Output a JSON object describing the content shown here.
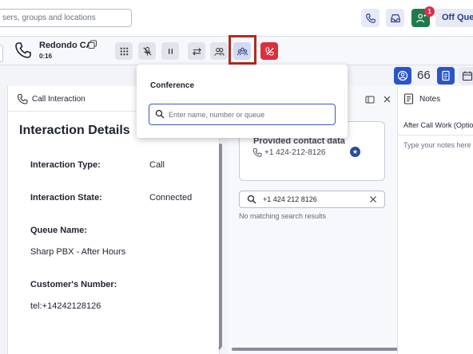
{
  "topbar": {
    "search_placeholder": "sers, groups and locations",
    "notification_count": "1",
    "status_label": "Off Que"
  },
  "call": {
    "caller_name": "Redondo CA",
    "timer": "0:16"
  },
  "row2": {
    "count": "66"
  },
  "conference": {
    "title": "Conference",
    "placeholder": "Enter name, number or queue"
  },
  "interaction_panel": {
    "header": "Call Interaction",
    "title": "Interaction Details",
    "fields": [
      {
        "label": "Interaction Type:",
        "value": "Call"
      },
      {
        "label": "Interaction State:",
        "value": "Connected"
      },
      {
        "label": "Queue Name:",
        "value": "Sharp PBX - After Hours"
      },
      {
        "label": "Customer's Number:",
        "value": "tel:+14242128126"
      }
    ]
  },
  "contact_panel": {
    "card_title": "Provided contact data",
    "card_phone": "+1 424-212-8126",
    "search_value": "+1 424 212 8126",
    "no_results": "No matching search results"
  },
  "notes_panel": {
    "header": "Notes",
    "subtitle": "After Call Work (Optio",
    "placeholder": "Type your notes here"
  },
  "colors": {
    "accent": "#2a3d8f",
    "end_call": "#dc2f3d",
    "highlight": "#b22a1e",
    "user_button": "#1f7a4a"
  }
}
